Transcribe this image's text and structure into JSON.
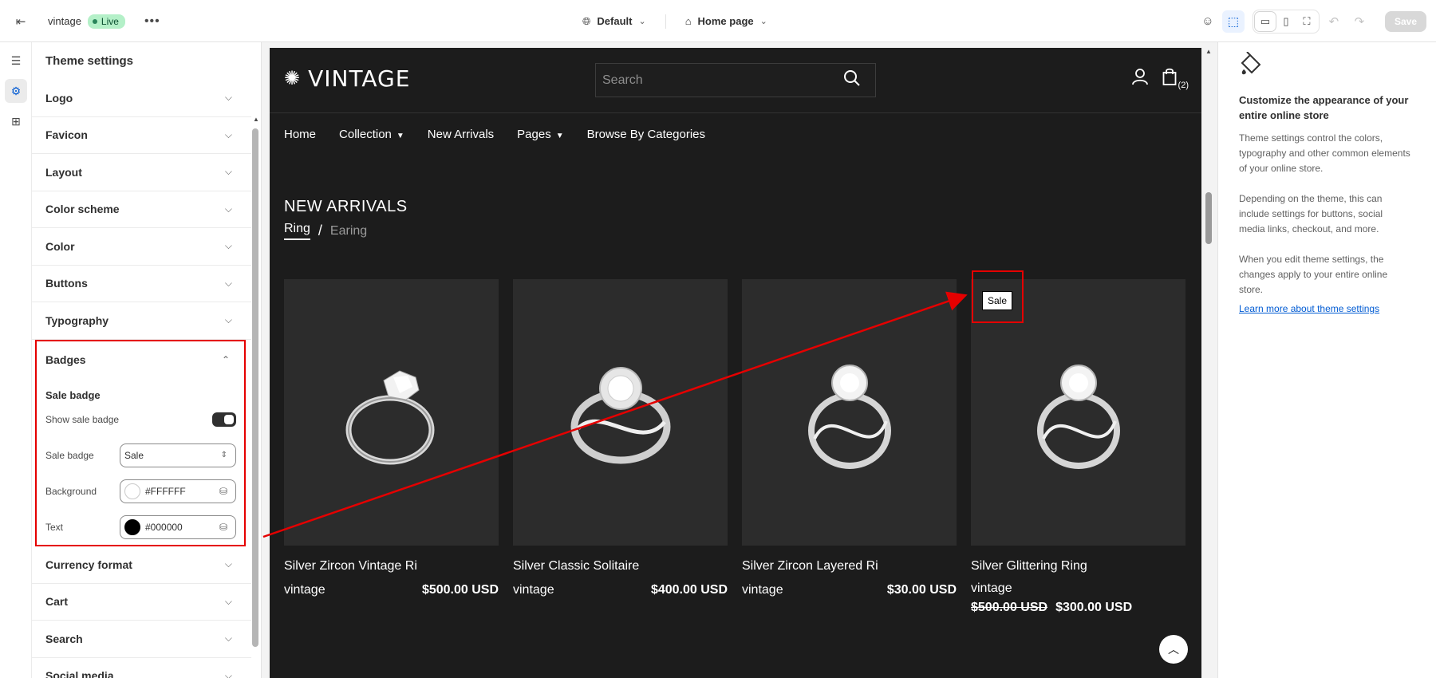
{
  "topbar": {
    "store_name": "vintage",
    "status_badge": "Live",
    "more": "•••",
    "theme_select": "Default",
    "page_select": "Home page",
    "save_label": "Save"
  },
  "panel": {
    "title": "Theme settings",
    "sections_top": [
      "Logo",
      "Favicon",
      "Layout",
      "Color scheme",
      "Color",
      "Buttons",
      "Typography"
    ],
    "badges": {
      "title": "Badges",
      "sub_heading": "Sale badge",
      "show_label": "Show sale badge",
      "show_value": true,
      "sale_badge_label": "Sale badge",
      "sale_badge_value": "Sale",
      "background_label": "Background",
      "background_value": "#FFFFFF",
      "text_label": "Text",
      "text_value": "#000000"
    },
    "sections_bottom": [
      "Currency format",
      "Cart",
      "Search",
      "Social media"
    ]
  },
  "store": {
    "logo": "VINTAGE",
    "search_placeholder": "Search",
    "cart_count": "(2)",
    "nav": [
      {
        "label": "Home"
      },
      {
        "label": "Collection",
        "dropdown": true
      },
      {
        "label": "New Arrivals"
      },
      {
        "label": "Pages",
        "dropdown": true
      },
      {
        "label": "Browse By Categories"
      }
    ],
    "section_title": "NEW ARRIVALS",
    "tab_active": "Ring",
    "tab_separator": "/",
    "tab_other": "Earing",
    "products": [
      {
        "title": "Silver Zircon Vintage Ri",
        "vendor": "vintage",
        "price": "$500.00 USD"
      },
      {
        "title": "Silver Classic Solitaire",
        "vendor": "vintage",
        "price": "$400.00 USD"
      },
      {
        "title": "Silver Zircon Layered Ri",
        "vendor": "vintage",
        "price": "$30.00 USD"
      },
      {
        "title": "Silver Glittering Ring",
        "vendor": "vintage",
        "compare_price": "$500.00 USD",
        "price": "$300.00 USD",
        "badge": "Sale"
      }
    ]
  },
  "info": {
    "title": "Customize the appearance of your entire online store",
    "p1": "Theme settings control the colors, typography and other common elements of your online store.",
    "p2": "Depending on the theme, this can include settings for buttons, social media links, checkout, and more.",
    "p3": "When you edit theme settings, the changes apply to your entire online store.",
    "link": "Learn more about theme settings"
  },
  "colors": {
    "accent": "#005bd3",
    "annotation": "#e50000",
    "live_badge": "#b4f0c8",
    "store_bg": "#1c1c1c"
  }
}
